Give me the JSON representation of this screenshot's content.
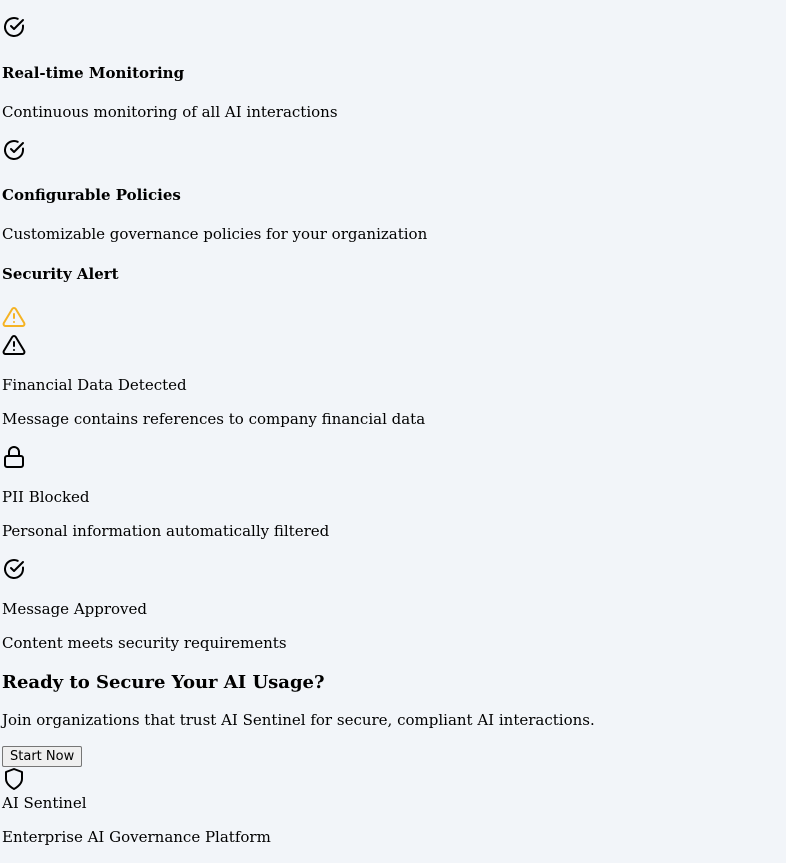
{
  "features": [
    {
      "icon": "check-circle-icon",
      "title": "Real-time Monitoring",
      "description": "Continuous monitoring of all AI interactions"
    },
    {
      "icon": "check-circle-icon",
      "title": "Configurable Policies",
      "description": "Customizable governance policies for your organization"
    }
  ],
  "alert": {
    "heading": "Security Alert",
    "warning_color": "#f5b324",
    "items": [
      {
        "icon": "warning-triangle-icon",
        "title": "Financial Data Detected",
        "description": "Message contains references to company financial data"
      },
      {
        "icon": "lock-icon",
        "title": "PII Blocked",
        "description": "Personal information automatically filtered"
      },
      {
        "icon": "check-circle-icon",
        "title": "Message Approved",
        "description": "Content meets security requirements"
      }
    ]
  },
  "cta": {
    "title": "Ready to Secure Your AI Usage?",
    "description": "Join organizations that trust AI Sentinel for secure, compliant AI interactions.",
    "button_label": "Start Now"
  },
  "footer": {
    "icon": "shield-icon",
    "brand": "AI Sentinel",
    "tagline": "Enterprise AI Governance Platform"
  }
}
